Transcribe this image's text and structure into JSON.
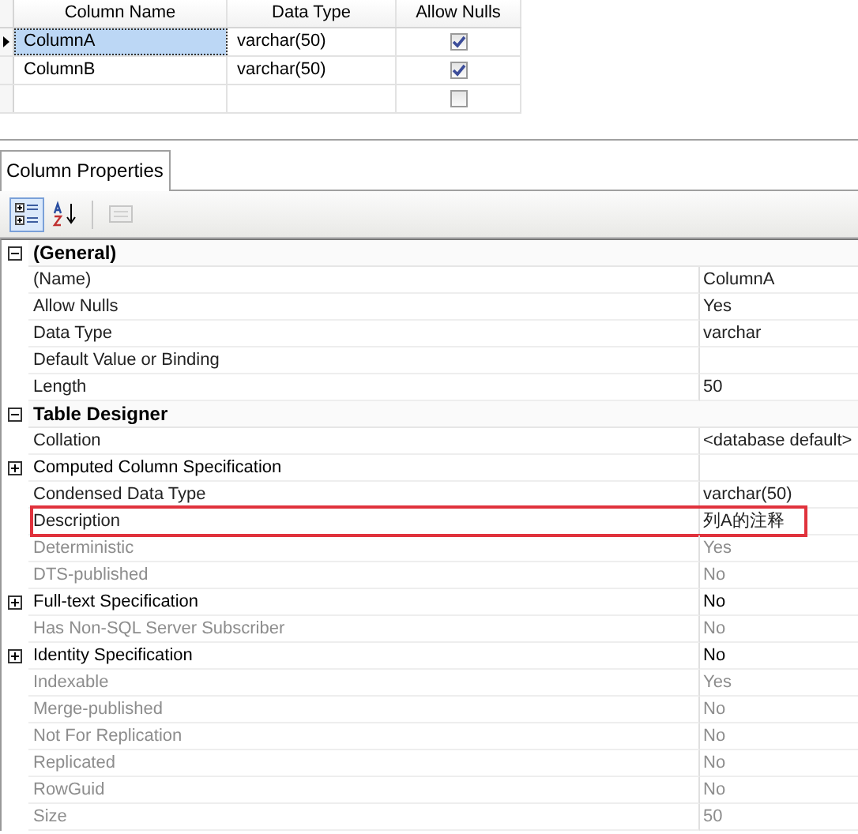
{
  "columns_grid": {
    "columns": [
      "Column Name",
      "Data Type",
      "Allow Nulls"
    ],
    "rows": [
      {
        "selected": true,
        "name": "ColumnA",
        "type": "varchar(50)",
        "allow_nulls": true
      },
      {
        "selected": false,
        "name": "ColumnB",
        "type": "varchar(50)",
        "allow_nulls": true
      },
      {
        "selected": false,
        "allow_nulls": false
      }
    ]
  },
  "tabs": [
    {
      "label": "Column Properties",
      "selected": true
    }
  ],
  "toolbar": [
    {
      "kind": "categorized",
      "selected": true,
      "disabled": false
    },
    {
      "kind": "alphabetical",
      "selected": false,
      "disabled": false
    },
    {
      "kind": "pages",
      "selected": false,
      "disabled": true
    }
  ],
  "property_grid": {
    "rows": [
      {
        "kind": "category",
        "label": "(General)",
        "expanded": true
      },
      {
        "kind": "property",
        "name": "(Name)",
        "value": "ColumnA",
        "disabled": false,
        "highlighted": false
      },
      {
        "kind": "property",
        "name": "Allow Nulls",
        "value": "Yes",
        "disabled": false,
        "highlighted": false
      },
      {
        "kind": "property",
        "name": "Data Type",
        "value": "varchar",
        "disabled": false,
        "highlighted": false
      },
      {
        "kind": "property",
        "name": "Default Value or Binding",
        "disabled": false,
        "highlighted": false
      },
      {
        "kind": "property",
        "name": "Length",
        "value": "50",
        "disabled": false,
        "highlighted": false
      },
      {
        "kind": "category",
        "label": "Table Designer",
        "expanded": true
      },
      {
        "kind": "property",
        "name": "Collation",
        "value": "<database default>",
        "disabled": false,
        "highlighted": false
      },
      {
        "kind": "property",
        "name": "Computed Column Specification",
        "disabled": false,
        "highlighted": false,
        "expanded": false
      },
      {
        "kind": "property",
        "name": "Condensed Data Type",
        "value": "varchar(50)",
        "disabled": false,
        "highlighted": false
      },
      {
        "kind": "property",
        "name": "Description",
        "value": "列A的注释",
        "disabled": false,
        "highlighted": true
      },
      {
        "kind": "property",
        "name": "Deterministic",
        "value": "Yes",
        "disabled": true,
        "highlighted": false
      },
      {
        "kind": "property",
        "name": "DTS-published",
        "value": "No",
        "disabled": true,
        "highlighted": false
      },
      {
        "kind": "property",
        "name": "Full-text Specification",
        "value": "No",
        "disabled": false,
        "highlighted": false,
        "expanded": false
      },
      {
        "kind": "property",
        "name": "Has Non-SQL Server Subscriber",
        "value": "No",
        "disabled": true,
        "highlighted": false
      },
      {
        "kind": "property",
        "name": "Identity Specification",
        "value": "No",
        "disabled": false,
        "highlighted": false,
        "expanded": false
      },
      {
        "kind": "property",
        "name": "Indexable",
        "value": "Yes",
        "disabled": true,
        "highlighted": false
      },
      {
        "kind": "property",
        "name": "Merge-published",
        "value": "No",
        "disabled": true,
        "highlighted": false
      },
      {
        "kind": "property",
        "name": "Not For Replication",
        "value": "No",
        "disabled": true,
        "highlighted": false
      },
      {
        "kind": "property",
        "name": "Replicated",
        "value": "No",
        "disabled": true,
        "highlighted": false
      },
      {
        "kind": "property",
        "name": "RowGuid",
        "value": "No",
        "disabled": true,
        "highlighted": false
      },
      {
        "kind": "property",
        "name": "Size",
        "value": "50",
        "disabled": true,
        "highlighted": false
      }
    ]
  }
}
